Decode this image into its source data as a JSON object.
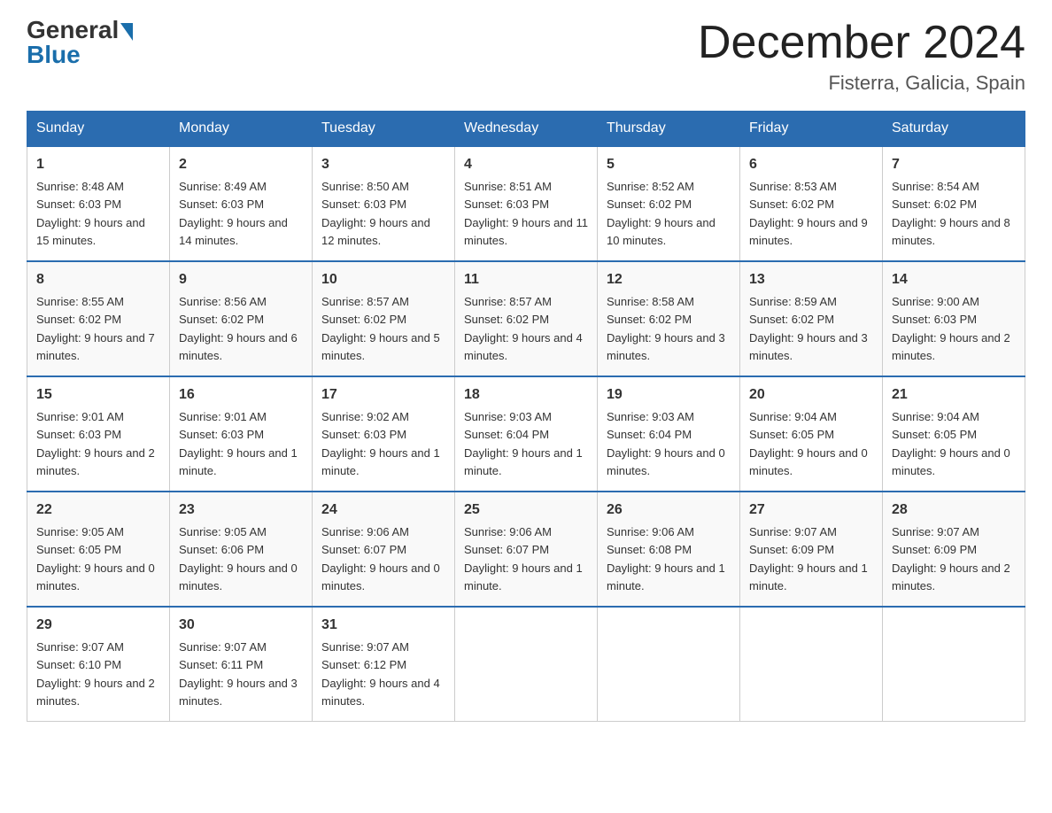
{
  "header": {
    "title": "December 2024",
    "location": "Fisterra, Galicia, Spain",
    "logo_general": "General",
    "logo_blue": "Blue"
  },
  "columns": [
    "Sunday",
    "Monday",
    "Tuesday",
    "Wednesday",
    "Thursday",
    "Friday",
    "Saturday"
  ],
  "weeks": [
    [
      {
        "day": "1",
        "sunrise": "8:48 AM",
        "sunset": "6:03 PM",
        "daylight": "9 hours and 15 minutes."
      },
      {
        "day": "2",
        "sunrise": "8:49 AM",
        "sunset": "6:03 PM",
        "daylight": "9 hours and 14 minutes."
      },
      {
        "day": "3",
        "sunrise": "8:50 AM",
        "sunset": "6:03 PM",
        "daylight": "9 hours and 12 minutes."
      },
      {
        "day": "4",
        "sunrise": "8:51 AM",
        "sunset": "6:03 PM",
        "daylight": "9 hours and 11 minutes."
      },
      {
        "day": "5",
        "sunrise": "8:52 AM",
        "sunset": "6:02 PM",
        "daylight": "9 hours and 10 minutes."
      },
      {
        "day": "6",
        "sunrise": "8:53 AM",
        "sunset": "6:02 PM",
        "daylight": "9 hours and 9 minutes."
      },
      {
        "day": "7",
        "sunrise": "8:54 AM",
        "sunset": "6:02 PM",
        "daylight": "9 hours and 8 minutes."
      }
    ],
    [
      {
        "day": "8",
        "sunrise": "8:55 AM",
        "sunset": "6:02 PM",
        "daylight": "9 hours and 7 minutes."
      },
      {
        "day": "9",
        "sunrise": "8:56 AM",
        "sunset": "6:02 PM",
        "daylight": "9 hours and 6 minutes."
      },
      {
        "day": "10",
        "sunrise": "8:57 AM",
        "sunset": "6:02 PM",
        "daylight": "9 hours and 5 minutes."
      },
      {
        "day": "11",
        "sunrise": "8:57 AM",
        "sunset": "6:02 PM",
        "daylight": "9 hours and 4 minutes."
      },
      {
        "day": "12",
        "sunrise": "8:58 AM",
        "sunset": "6:02 PM",
        "daylight": "9 hours and 3 minutes."
      },
      {
        "day": "13",
        "sunrise": "8:59 AM",
        "sunset": "6:02 PM",
        "daylight": "9 hours and 3 minutes."
      },
      {
        "day": "14",
        "sunrise": "9:00 AM",
        "sunset": "6:03 PM",
        "daylight": "9 hours and 2 minutes."
      }
    ],
    [
      {
        "day": "15",
        "sunrise": "9:01 AM",
        "sunset": "6:03 PM",
        "daylight": "9 hours and 2 minutes."
      },
      {
        "day": "16",
        "sunrise": "9:01 AM",
        "sunset": "6:03 PM",
        "daylight": "9 hours and 1 minute."
      },
      {
        "day": "17",
        "sunrise": "9:02 AM",
        "sunset": "6:03 PM",
        "daylight": "9 hours and 1 minute."
      },
      {
        "day": "18",
        "sunrise": "9:03 AM",
        "sunset": "6:04 PM",
        "daylight": "9 hours and 1 minute."
      },
      {
        "day": "19",
        "sunrise": "9:03 AM",
        "sunset": "6:04 PM",
        "daylight": "9 hours and 0 minutes."
      },
      {
        "day": "20",
        "sunrise": "9:04 AM",
        "sunset": "6:05 PM",
        "daylight": "9 hours and 0 minutes."
      },
      {
        "day": "21",
        "sunrise": "9:04 AM",
        "sunset": "6:05 PM",
        "daylight": "9 hours and 0 minutes."
      }
    ],
    [
      {
        "day": "22",
        "sunrise": "9:05 AM",
        "sunset": "6:05 PM",
        "daylight": "9 hours and 0 minutes."
      },
      {
        "day": "23",
        "sunrise": "9:05 AM",
        "sunset": "6:06 PM",
        "daylight": "9 hours and 0 minutes."
      },
      {
        "day": "24",
        "sunrise": "9:06 AM",
        "sunset": "6:07 PM",
        "daylight": "9 hours and 0 minutes."
      },
      {
        "day": "25",
        "sunrise": "9:06 AM",
        "sunset": "6:07 PM",
        "daylight": "9 hours and 1 minute."
      },
      {
        "day": "26",
        "sunrise": "9:06 AM",
        "sunset": "6:08 PM",
        "daylight": "9 hours and 1 minute."
      },
      {
        "day": "27",
        "sunrise": "9:07 AM",
        "sunset": "6:09 PM",
        "daylight": "9 hours and 1 minute."
      },
      {
        "day": "28",
        "sunrise": "9:07 AM",
        "sunset": "6:09 PM",
        "daylight": "9 hours and 2 minutes."
      }
    ],
    [
      {
        "day": "29",
        "sunrise": "9:07 AM",
        "sunset": "6:10 PM",
        "daylight": "9 hours and 2 minutes."
      },
      {
        "day": "30",
        "sunrise": "9:07 AM",
        "sunset": "6:11 PM",
        "daylight": "9 hours and 3 minutes."
      },
      {
        "day": "31",
        "sunrise": "9:07 AM",
        "sunset": "6:12 PM",
        "daylight": "9 hours and 4 minutes."
      },
      null,
      null,
      null,
      null
    ]
  ]
}
